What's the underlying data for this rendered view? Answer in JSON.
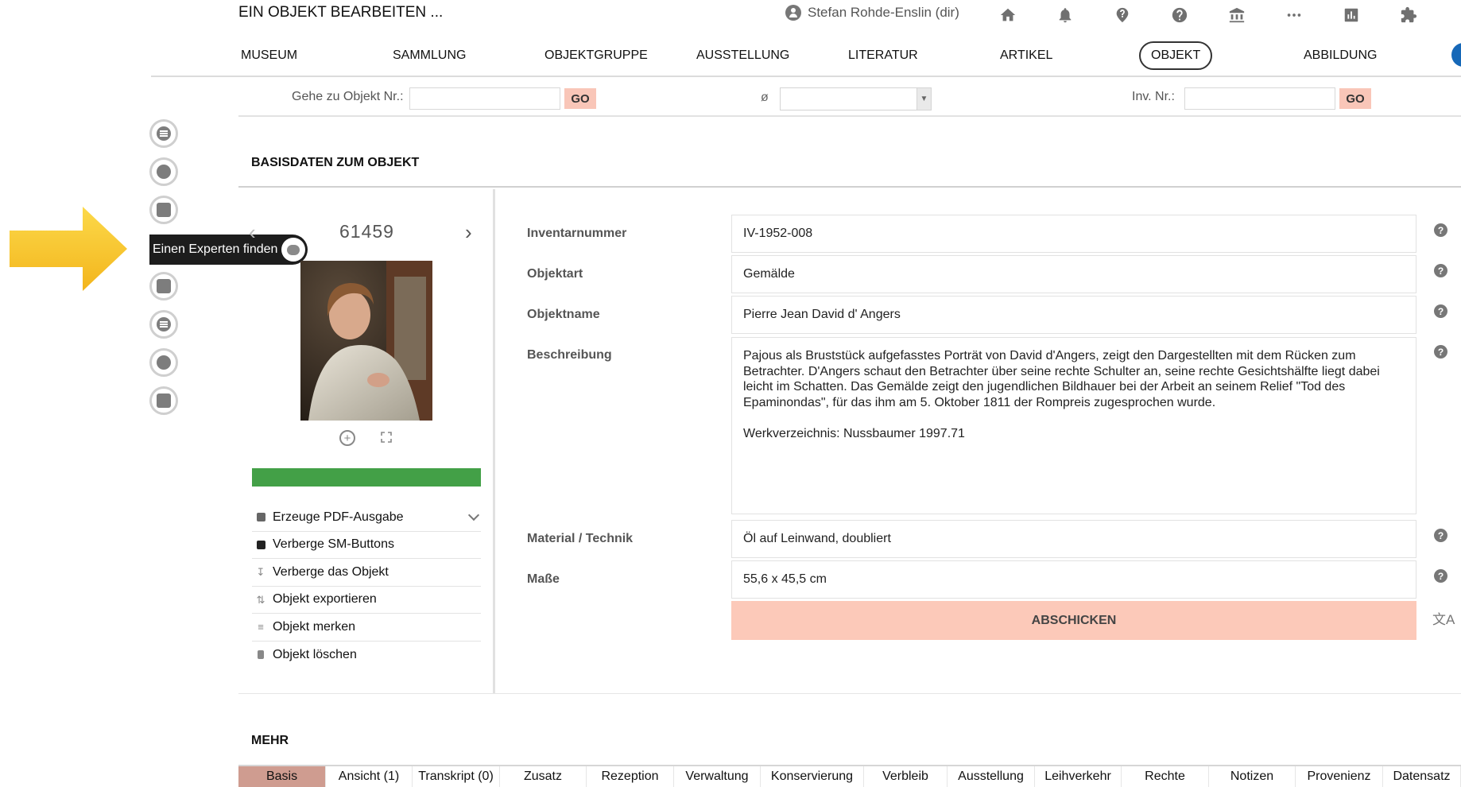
{
  "header": {
    "title": "EIN OBJEKT BEARBEITEN ...",
    "user": "Stefan Rohde-Enslin (dir)",
    "icons": [
      "home-icon",
      "bell-icon",
      "help-icon",
      "help-circle-icon",
      "museum-icon",
      "more-icon",
      "stats-icon",
      "puzzle-icon"
    ]
  },
  "nav": {
    "items": [
      {
        "label": "MUSEUM"
      },
      {
        "label": "SAMMLUNG"
      },
      {
        "label": "OBJEKTGRUPPE"
      },
      {
        "label": "AUSSTELLUNG"
      },
      {
        "label": "LITERATUR"
      },
      {
        "label": "ARTIKEL"
      },
      {
        "label": "OBJEKT",
        "active": true
      },
      {
        "label": "ABBILDUNG"
      }
    ]
  },
  "search": {
    "goto_label": "Gehe zu Objekt Nr.:",
    "goto_value": "",
    "go_label": "GO",
    "filter_symbol": "ø",
    "filter_value": "",
    "inv_label": "Inv. Nr.:",
    "inv_value": ""
  },
  "sidebar": {
    "tooltip": "Einen Experten finden"
  },
  "basis": {
    "title": "BASISDATEN ZUM OBJEKT",
    "object_id": "61459",
    "progress": 1.0,
    "actions": [
      {
        "label": "Erzeuge PDF-Ausgabe",
        "icon": "pdf-icon"
      },
      {
        "label": "Verberge SM-Buttons",
        "icon": "share-icon"
      },
      {
        "label": "Verberge das Objekt",
        "icon": "download-icon"
      },
      {
        "label": "Objekt exportieren",
        "icon": "export-icon"
      },
      {
        "label": "Objekt merken",
        "icon": "playlist-add-icon"
      },
      {
        "label": "Objekt löschen",
        "icon": "trash-icon"
      }
    ]
  },
  "form": {
    "fields": [
      {
        "label": "Inventarnummer",
        "value": "IV-1952-008"
      },
      {
        "label": "Objektart",
        "value": "Gemälde"
      },
      {
        "label": "Objektname",
        "value": "Pierre Jean David d' Angers"
      },
      {
        "label": "Beschreibung",
        "value": "Pajous als Bruststück aufgefasstes Porträt von David d'Angers, zeigt den Dargestellten mit dem Rücken zum Betrachter. D'Angers schaut den Betrachter über seine rechte Schulter an, seine rechte Gesichtshälfte liegt dabei leicht im Schatten. Das Gemälde zeigt den jugendlichen Bildhauer bei der Arbeit an seinem Relief \"Tod des Epaminondas\", für das ihm am 5. Oktober 1811 der Rompreis zugesprochen wurde.\n\nWerkverzeichnis: Nussbaumer 1997.71"
      },
      {
        "label": "Material / Technik",
        "value": "Öl auf Leinwand, doubliert"
      },
      {
        "label": "Maße",
        "value": "55,6 x 45,5 cm"
      }
    ],
    "help_symbol": "?",
    "submit_label": "ABSCHICKEN"
  },
  "more": {
    "title": "MEHR",
    "tabs": [
      {
        "label": "Basis",
        "active": true
      },
      {
        "label": "Ansicht (1)"
      },
      {
        "label": "Transkript (0)"
      },
      {
        "label": "Zusatz"
      },
      {
        "label": "Rezeption"
      },
      {
        "label": "Verwaltung"
      },
      {
        "label": "Konservierung"
      },
      {
        "label": "Verbleib"
      },
      {
        "label": "Ausstellung"
      },
      {
        "label": "Leihverkehr"
      },
      {
        "label": "Rechte"
      },
      {
        "label": "Notizen"
      },
      {
        "label": "Provenienz"
      },
      {
        "label": "Datensatz"
      }
    ]
  },
  "colors": {
    "accent_go": "#f9c6b8",
    "progress": "#43a047",
    "active_tab": "#cf9c90",
    "tooltip_bg": "#1d1d1d",
    "arrow": "#f6c12a"
  }
}
